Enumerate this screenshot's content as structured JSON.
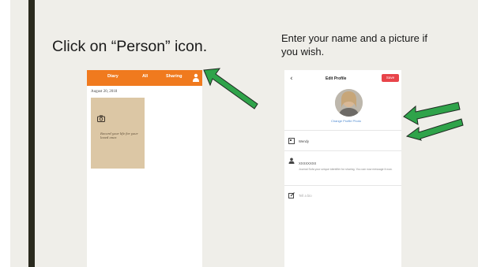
{
  "left_instruction": "Click on “Person” icon.",
  "right_instruction": "Enter your  name and a picture if you wish.",
  "left_phone": {
    "tabs": [
      "Diary",
      "All",
      "Sharing"
    ],
    "date": "August 20, 2018",
    "entry_text": "Record your life for your loved ones"
  },
  "right_phone": {
    "back": "‹",
    "title": "Edit Profile",
    "save": "Save",
    "change_photo": "Change Profile Photo",
    "name_row": "Wendy",
    "bio_row": "XXXXXXXX",
    "bio_desc": "Journal Sofa your unique identifier for sharing. You can now message it now.",
    "third_row": "Tell a bio"
  },
  "colors": {
    "accent": "#f07a1e",
    "arrow": "#2fa34a",
    "save": "#e8444a"
  }
}
